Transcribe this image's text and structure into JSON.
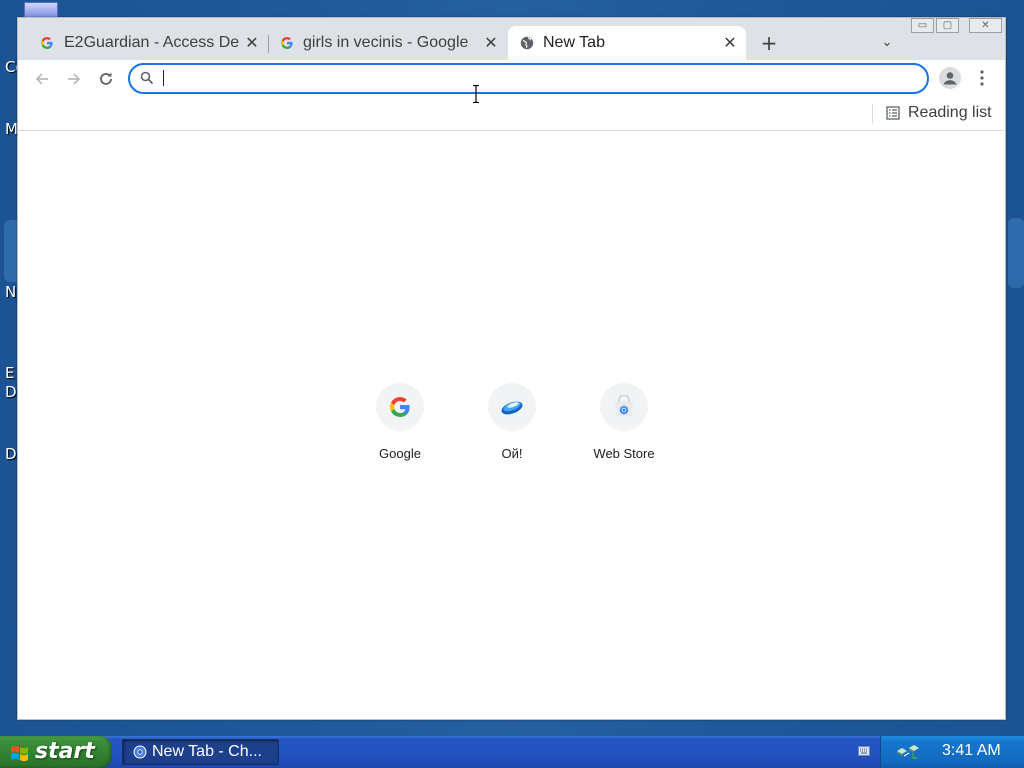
{
  "desktop": {
    "icon_labels": [
      "Co",
      "M",
      "N",
      "E",
      "D",
      "D"
    ]
  },
  "browser": {
    "tabs": [
      {
        "title": "E2Guardian - Access De",
        "favicon": "google-g-icon",
        "active": false
      },
      {
        "title": "girls in vecinis - Google S",
        "favicon": "google-g-icon",
        "active": false
      },
      {
        "title": "New Tab",
        "favicon": "globe-icon",
        "active": true
      }
    ],
    "window_controls": {
      "minimize": "▭",
      "maximize": "▢",
      "close": "✕"
    },
    "new_tab_label": "+",
    "tab_search_label": "⌄",
    "omnibox": {
      "value": "",
      "placeholder": ""
    },
    "reading_list_label": "Reading list",
    "shortcuts": [
      {
        "label": "Google",
        "icon": "google-g-icon"
      },
      {
        "label": "Ой!",
        "icon": "oi-logo-icon"
      },
      {
        "label": "Web Store",
        "icon": "web-store-icon"
      }
    ]
  },
  "taskbar": {
    "start_label": "start",
    "task_items": [
      {
        "label": "New Tab - Ch...",
        "icon": "chrome-icon"
      }
    ],
    "clock": "3:41 AM"
  },
  "colors": {
    "accent": "#1a73e8",
    "tabstrip_bg": "#dee1e6",
    "taskbar_blue": "#2251be",
    "start_green": "#2f7d2f",
    "tray_blue": "#1476cd"
  }
}
